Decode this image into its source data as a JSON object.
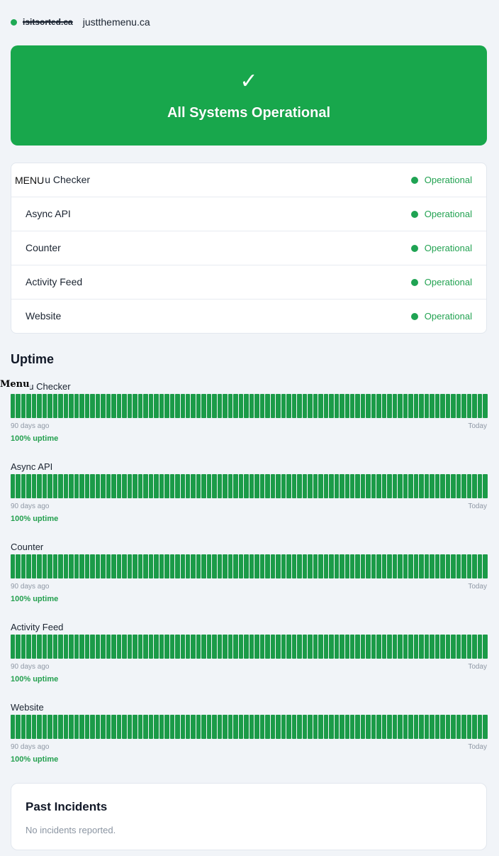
{
  "header": {
    "old_domain": "isitsorted.ca",
    "domain": "justthemenu.ca"
  },
  "banner": {
    "check_glyph": "✓",
    "title": "All Systems Operational"
  },
  "overlay_labels": {
    "components_menu": "MENU",
    "uptime_menu": "Menu"
  },
  "components": [
    {
      "name": "Menu Checker",
      "status": "Operational"
    },
    {
      "name": "Async API",
      "status": "Operational"
    },
    {
      "name": "Counter",
      "status": "Operational"
    },
    {
      "name": "Activity Feed",
      "status": "Operational"
    },
    {
      "name": "Website",
      "status": "Operational"
    }
  ],
  "uptime": {
    "heading": "Uptime",
    "start_label": "90 days ago",
    "end_label": "Today",
    "bar_color": "#1b9b48",
    "days": 90,
    "services": [
      {
        "name": "Menu Checker",
        "uptime": "100% uptime"
      },
      {
        "name": "Async API",
        "uptime": "100% uptime"
      },
      {
        "name": "Counter",
        "uptime": "100% uptime"
      },
      {
        "name": "Activity Feed",
        "uptime": "100% uptime"
      },
      {
        "name": "Website",
        "uptime": "100% uptime"
      }
    ]
  },
  "incidents": {
    "title": "Past Incidents",
    "empty_text": "No incidents reported."
  },
  "colors": {
    "operational_green": "#18a74c",
    "status_text": "#22a251",
    "background": "#f1f4f8"
  }
}
